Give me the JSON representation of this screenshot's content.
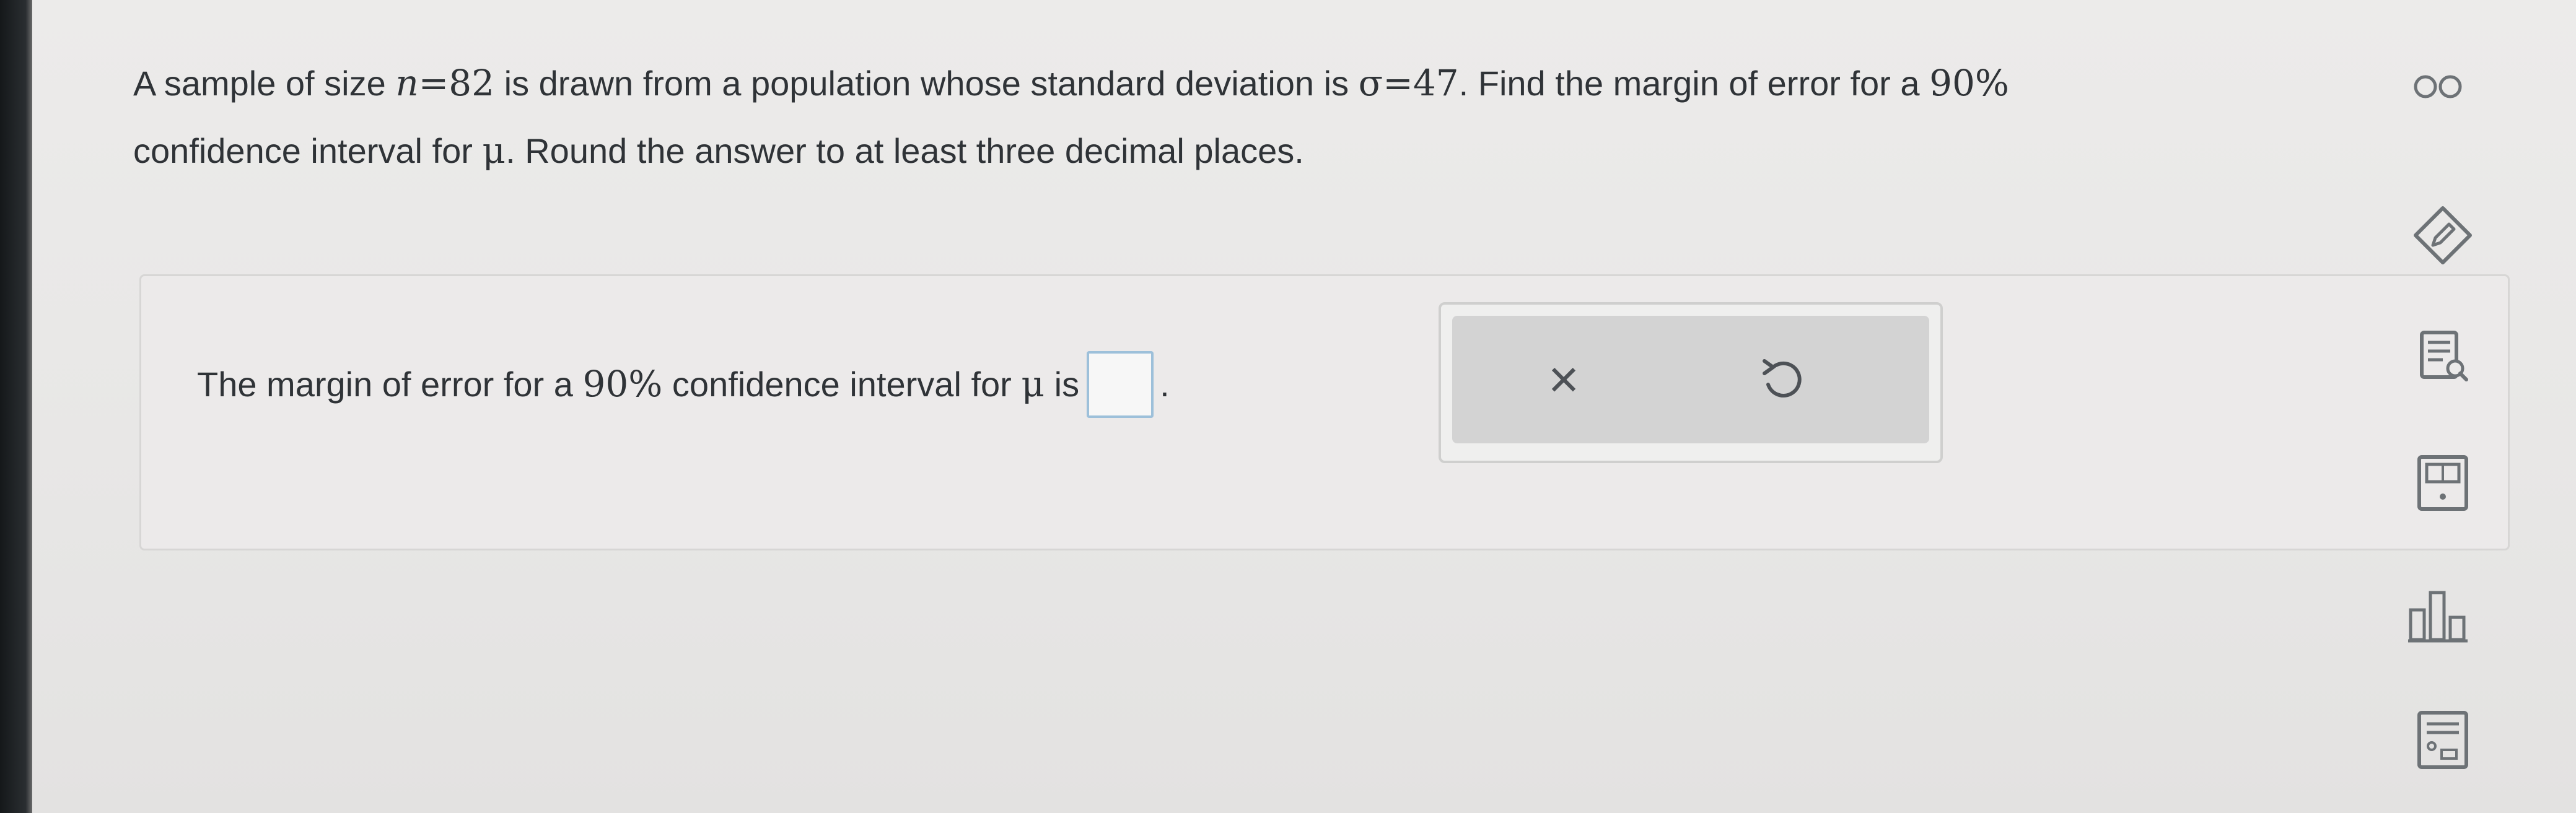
{
  "question": {
    "part1": "A sample of size ",
    "n_var": "n",
    "n_eq": "=82",
    "part2": " is drawn from a population whose standard deviation is ",
    "sigma_eq": "σ=47",
    "part3": ". Find the margin of error for a ",
    "pct": "90%",
    "part4": "confidence interval for ",
    "mu": "μ",
    "part5": ". Round the answer to at least three decimal places."
  },
  "answer": {
    "prefix": "The margin of error for a ",
    "pct": "90%",
    "middle": " confidence interval for ",
    "mu": "μ",
    "suffix": " is",
    "value": "",
    "period": "."
  },
  "tools": {
    "clear_symbol": "×"
  },
  "sidebar": {
    "icons": [
      "infinity-icon",
      "pencil-icon",
      "notes-icon",
      "calculator-icon",
      "bar-chart-icon",
      "data-table-icon"
    ]
  },
  "colors": {
    "answer_box_border": "#9dc0da",
    "icon_gray": "#6d7276"
  }
}
